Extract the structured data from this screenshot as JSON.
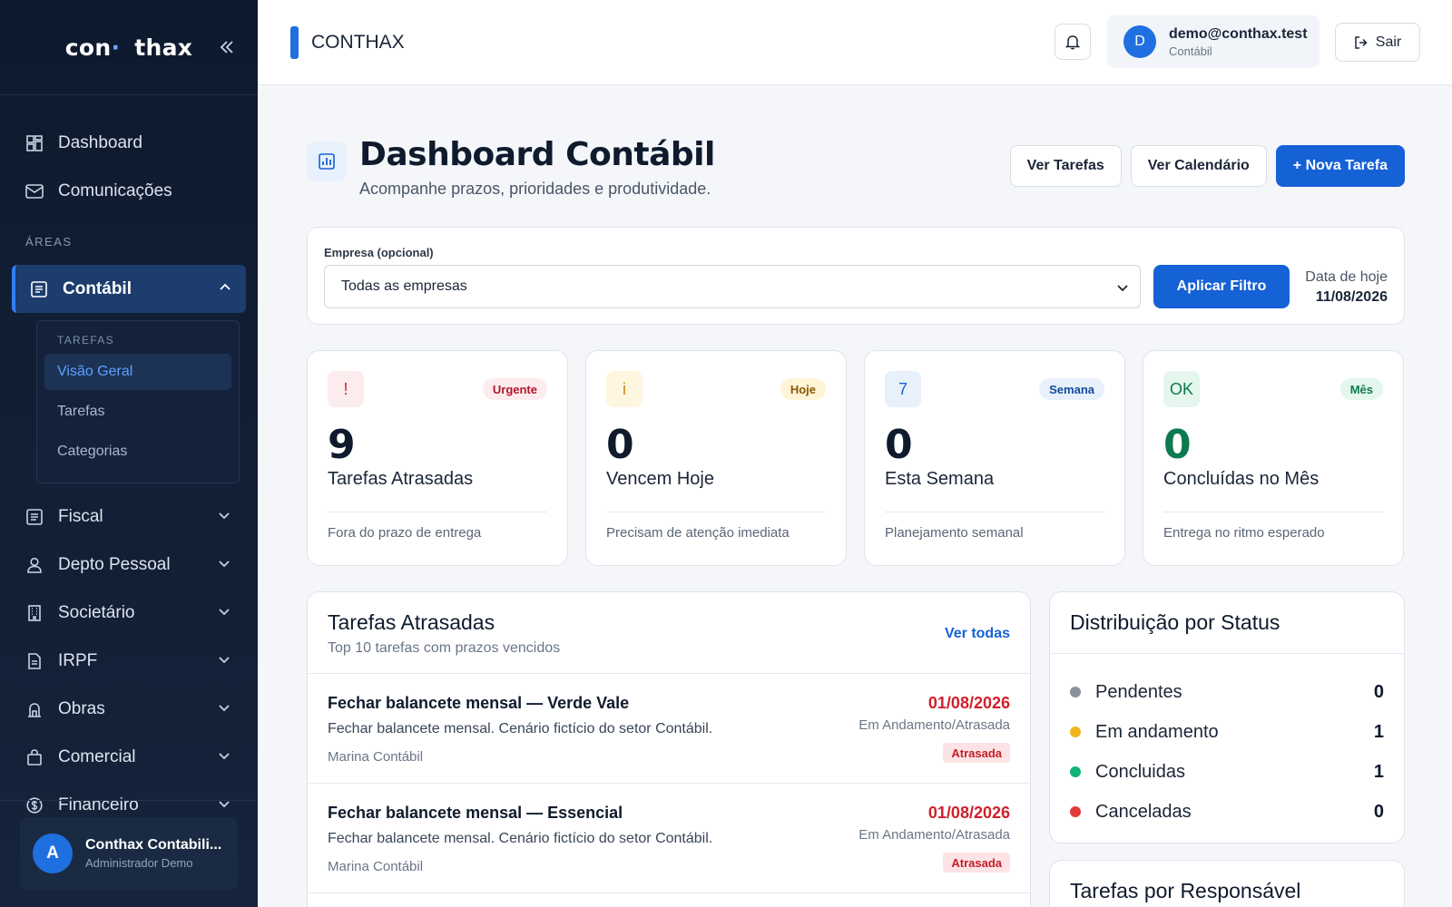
{
  "sidebar": {
    "logo": {
      "left": "con",
      "dot": "·",
      "right": "thax"
    },
    "nav": [
      {
        "label": "Dashboard",
        "icon": "grid-icon"
      },
      {
        "label": "Comunicações",
        "icon": "mail-icon"
      }
    ],
    "section_label": "ÁREAS",
    "active_area": {
      "label": "Contábil",
      "icon": "ledger-icon"
    },
    "submenu": {
      "title": "TAREFAS",
      "items": [
        {
          "label": "Visão Geral",
          "active": true
        },
        {
          "label": "Tarefas",
          "active": false
        },
        {
          "label": "Categorias",
          "active": false
        }
      ]
    },
    "areas": [
      {
        "label": "Fiscal",
        "icon": "receipt-icon"
      },
      {
        "label": "Depto Pessoal",
        "icon": "person-icon"
      },
      {
        "label": "Societário",
        "icon": "building-icon"
      },
      {
        "label": "IRPF",
        "icon": "document-icon"
      },
      {
        "label": "Obras",
        "icon": "construction-icon"
      },
      {
        "label": "Comercial",
        "icon": "bag-icon"
      },
      {
        "label": "Financeiro",
        "icon": "dollar-icon"
      }
    ],
    "footer": {
      "avatar": "A",
      "name": "Conthax Contabili...",
      "role": "Administrador Demo"
    }
  },
  "topbar": {
    "title": "CONTHAX",
    "user": {
      "avatar": "D",
      "email": "demo@conthax.test",
      "role": "Contábil"
    },
    "logout_label": "Sair"
  },
  "page": {
    "title": "Dashboard Contábil",
    "subtitle": "Acompanhe prazos, prioridades e produtividade.",
    "buttons": {
      "tasks": "Ver Tarefas",
      "calendar": "Ver Calendário",
      "new_task": "+ Nova Tarefa"
    }
  },
  "filter": {
    "label": "Empresa (opcional)",
    "selected": "Todas as empresas",
    "apply": "Aplicar Filtro",
    "date_label": "Data de hoje",
    "date_value": "11/08/2026"
  },
  "cards": [
    {
      "icon_text": "!",
      "badge": "Urgente",
      "value": "9",
      "label": "Tarefas Atrasadas",
      "foot": "Fora do prazo de entrega",
      "accent": "#d11f2a",
      "icon_bg": "#fdecee",
      "badge_bg": "#fdecee",
      "num_color": "#0f1b2d"
    },
    {
      "icon_text": "i",
      "badge": "Hoje",
      "value": "0",
      "label": "Vencem Hoje",
      "foot": "Precisam de atenção imediata",
      "accent": "#b36b00",
      "icon_bg": "#fff6e0",
      "badge_bg": "#fff4d6",
      "num_color": "#0f1b2d"
    },
    {
      "icon_text": "7",
      "badge": "Semana",
      "value": "0",
      "label": "Esta Semana",
      "foot": "Planejamento semanal",
      "accent": "#1561d6",
      "icon_bg": "#e8f0fb",
      "badge_bg": "#e8f0fb",
      "num_color": "#0f1b2d"
    },
    {
      "icon_text": "OK",
      "badge": "Mês",
      "value": "0",
      "label": "Concluídas no Mês",
      "foot": "Entrega no ritmo esperado",
      "accent": "#0e7a4f",
      "icon_bg": "#e4f6ee",
      "badge_bg": "#e4f6ee",
      "num_color": "#0e7a4f"
    }
  ],
  "late_tasks": {
    "title": "Tarefas Atrasadas",
    "subtitle": "Top 10 tarefas com prazos vencidos",
    "link": "Ver todas",
    "rows": [
      {
        "title": "Fechar balancete mensal — Verde Vale",
        "desc": "Fechar balancete mensal. Cenário fictício do setor Contábil.",
        "who": "Marina Contábil",
        "date": "01/08/2026",
        "status": "Em Andamento/Atrasada",
        "badge": "Atrasada"
      },
      {
        "title": "Fechar balancete mensal — Essencial",
        "desc": "Fechar balancete mensal. Cenário fictício do setor Contábil.",
        "who": "Marina Contábil",
        "date": "01/08/2026",
        "status": "Em Andamento/Atrasada",
        "badge": "Atrasada"
      }
    ]
  },
  "distribution": {
    "title": "Distribuição por Status",
    "items": [
      {
        "label": "Pendentes",
        "value": "0",
        "color": "#8a929e"
      },
      {
        "label": "Em andamento",
        "value": "1",
        "color": "#f2b51e"
      },
      {
        "label": "Concluidas",
        "value": "1",
        "color": "#12b47a"
      },
      {
        "label": "Canceladas",
        "value": "0",
        "color": "#e23a3a"
      }
    ]
  },
  "responsible": {
    "title": "Tarefas por Responsável"
  }
}
